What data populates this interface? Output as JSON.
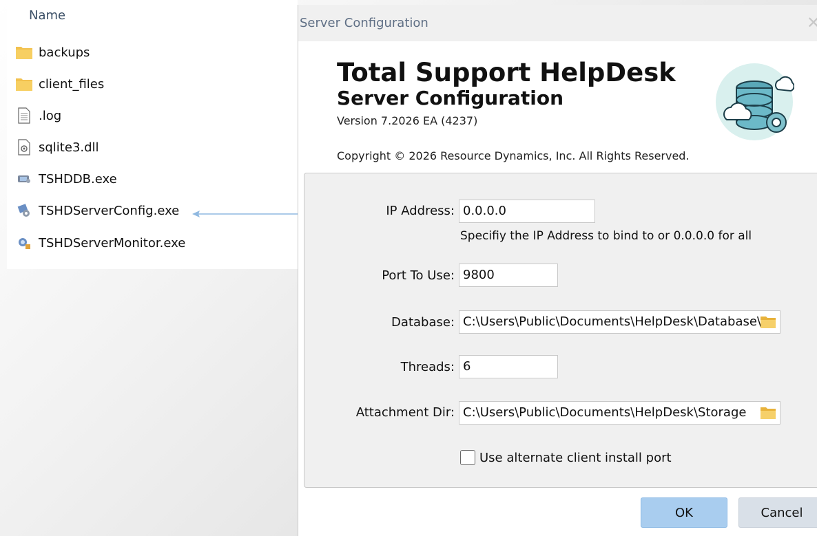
{
  "explorer": {
    "column_header": "Name",
    "sort_indicator": "^",
    "files": [
      {
        "name": "backups",
        "icon": "folder-icon"
      },
      {
        "name": "client_files",
        "icon": "folder-icon"
      },
      {
        "name": ".log",
        "icon": "text-file-icon"
      },
      {
        "name": "sqlite3.dll",
        "icon": "dll-file-icon"
      },
      {
        "name": "TSHDDB.exe",
        "icon": "database-exe-icon"
      },
      {
        "name": "TSHDServerConfig.exe",
        "icon": "config-exe-icon"
      },
      {
        "name": "TSHDServerMonitor.exe",
        "icon": "monitor-exe-icon"
      }
    ]
  },
  "dialog": {
    "title": "Server Configuration",
    "close_glyph": "✕",
    "product_name": "Total Support HelpDesk",
    "product_subtitle": "Server Configuration",
    "version": "Version 7.2026 EA (4237)",
    "copyright": "Copyright © 2026 Resource Dynamics, Inc. All Rights Reserved.",
    "logo_icon": "database-cloud-gear-icon",
    "fields": {
      "ip_label": "IP Address:",
      "ip_value": "0.0.0.0",
      "ip_hint": "Specifiy the IP Address to bind to or 0.0.0.0 for all",
      "port_label": "Port To Use:",
      "port_value": "9800",
      "database_label": "Database:",
      "database_value": "C:\\Users\\Public\\Documents\\HelpDesk\\Database\\",
      "threads_label": "Threads:",
      "threads_value": "6",
      "attachment_label": "Attachment Dir:",
      "attachment_value": "C:\\Users\\Public\\Documents\\HelpDesk\\Storage"
    },
    "alternate_port_label": "Use alternate client install port",
    "alternate_port_checked": false,
    "ok_label": "OK",
    "cancel_label": "Cancel"
  },
  "colors": {
    "ok_button": "#a9cdef",
    "cancel_button": "#d9e0e8",
    "folder": "#f2c14e",
    "arrow": "#8fb8e0"
  }
}
